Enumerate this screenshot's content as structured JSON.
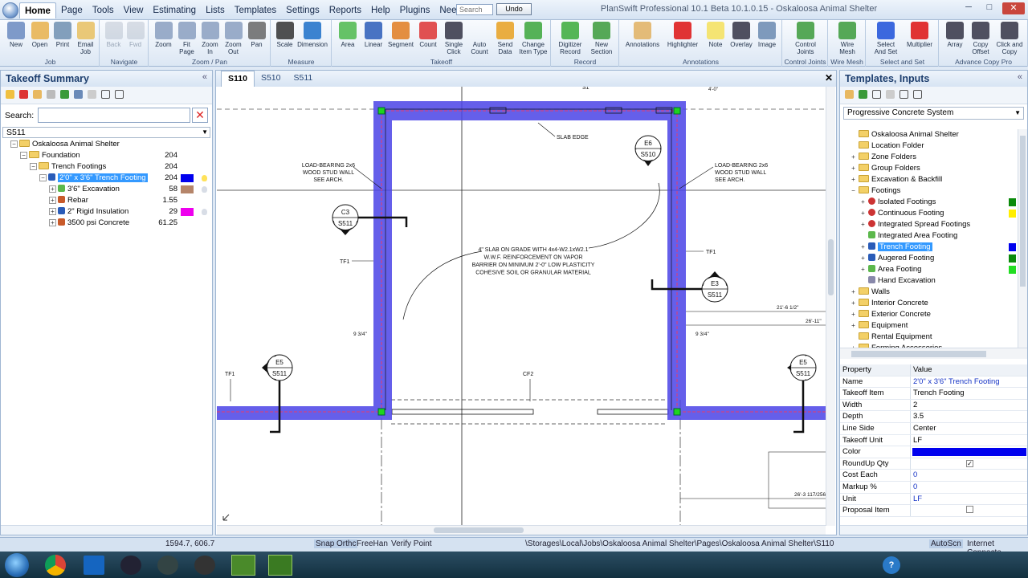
{
  "menu": {
    "items": [
      "Home",
      "Page",
      "Tools",
      "View",
      "Estimating",
      "Lists",
      "Templates",
      "Settings",
      "Reports",
      "Help",
      "Plugins",
      "Need Work?"
    ],
    "search_placeholder": "Search",
    "undo_label": "Undo"
  },
  "window_title": "PlanSwift Professional 10.1 Beta  10.1.0.15 - Oskaloosa Animal Shelter",
  "ribbon": {
    "groups": [
      {
        "label": "Job",
        "buttons": [
          "New",
          "Open",
          "Print",
          "Email\nJob"
        ]
      },
      {
        "label": "Navigate",
        "buttons": [
          "Back",
          "Fwd"
        ]
      },
      {
        "label": "Zoom / Pan",
        "buttons": [
          "Zoom",
          "Fit\nPage",
          "Zoom\nIn",
          "Zoom\nOut",
          "Pan"
        ]
      },
      {
        "label": "Measure",
        "buttons": [
          "Scale",
          "Dimension"
        ]
      },
      {
        "label": "Takeoff",
        "buttons": [
          "Area",
          "Linear",
          "Segment",
          "Count",
          "Single\nClick",
          "Auto\nCount",
          "Send\nData",
          "Change\nItem Type"
        ]
      },
      {
        "label": "Record",
        "buttons": [
          "Digitizer\nRecord",
          "New\nSection"
        ]
      },
      {
        "label": "Annotations",
        "buttons": [
          "Annotations",
          "Highlighter",
          "Note",
          "Overlay",
          "Image"
        ]
      },
      {
        "label": "Control Joints",
        "buttons": [
          "Control\nJoints"
        ]
      },
      {
        "label": "Wire Mesh",
        "buttons": [
          "Wire\nMesh"
        ]
      },
      {
        "label": "Select and Set",
        "buttons": [
          "Select\nAnd Set",
          "Multiplier"
        ]
      },
      {
        "label": "Advance Copy Pro",
        "buttons": [
          "Array",
          "Copy\nOffset",
          "Click and\nCopy"
        ]
      }
    ]
  },
  "left_panel": {
    "title": "Takeoff Summary",
    "search_label": "Search:",
    "page_select": "S511",
    "tree": [
      {
        "label": "Oskaloosa Animal Shelter",
        "value": "",
        "level": 0,
        "kind": "folder"
      },
      {
        "label": "Foundation",
        "value": "204",
        "level": 1,
        "kind": "folder"
      },
      {
        "label": "Trench Footings",
        "value": "204",
        "level": 2,
        "kind": "folder"
      },
      {
        "label": "2'0\" x 3'6\" Trench Footing",
        "value": "204",
        "level": 3,
        "kind": "linear",
        "selected": true,
        "swatch": "#0000ee"
      },
      {
        "label": "3'6\" Excavation",
        "value": "58",
        "level": 4,
        "kind": "area",
        "swatch": "#b5856a"
      },
      {
        "label": "Rebar",
        "value": "1.55",
        "level": 4,
        "kind": "item"
      },
      {
        "label": "2\" Rigid Insulation",
        "value": "29",
        "level": 4,
        "kind": "linear",
        "swatch": "#ee00ee"
      },
      {
        "label": "3500 psi Concrete",
        "value": "61.25",
        "level": 4,
        "kind": "item"
      }
    ]
  },
  "tabs": [
    "S110",
    "S510",
    "S511"
  ],
  "drawing": {
    "labels": {
      "slab_edge": "SLAB EDGE",
      "left_wall": [
        "LOAD-BEARING 2x6",
        "WOOD STUD WALL",
        "SEE ARCH."
      ],
      "right_wall": [
        "LOAD-BEARING 2x6",
        "WOOD STUD WALL",
        "SEE ARCH."
      ],
      "slab_note": [
        "4\" SLAB ON GRADE WITH 4x4-W2.1xW2.1",
        "W.W.F. REINFORCEMENT ON VAPOR",
        "BARRIER ON MINIMUM 2'-0\" LOW PLASTICITY",
        "COHESIVE SOIL OR GRANULAR MATERIAL"
      ],
      "tf1": "TF1",
      "cf2": "CF2",
      "dim_9_3_4": "9 3/4\"",
      "dim_21_6": "21'-6 1/2\"",
      "dim_26_11": "26'-11\"",
      "dim_26_3": "26'-3 117/256\"",
      "s1": "S1",
      "four_zero": "4'-0\""
    },
    "callouts": [
      {
        "top": "E6",
        "bottom": "S510"
      },
      {
        "top": "C3",
        "bottom": "S511"
      },
      {
        "top": "E3",
        "bottom": "S511"
      },
      {
        "top": "E5",
        "bottom": "S511"
      },
      {
        "top": "E5",
        "bottom": "S511"
      }
    ]
  },
  "right_panel": {
    "title": "Templates, Inputs",
    "template_select": "Progressive Concrete System",
    "tree": [
      {
        "label": "Oskaloosa Animal Shelter",
        "level": 0,
        "kind": "folder"
      },
      {
        "label": "Location Folder",
        "level": 0,
        "kind": "folder"
      },
      {
        "label": "Zone Folders",
        "level": 0,
        "kind": "folder",
        "expand": "+"
      },
      {
        "label": "Group Folders",
        "level": 0,
        "kind": "folder",
        "expand": "+"
      },
      {
        "label": "Excavation & Backfill",
        "level": 0,
        "kind": "folder",
        "expand": "+"
      },
      {
        "label": "Footings",
        "level": 0,
        "kind": "folder",
        "expand": "-"
      },
      {
        "label": "Isolated Footings",
        "level": 1,
        "kind": "count",
        "swatch": "#0a8a0a",
        "expand": "+"
      },
      {
        "label": "Continuous Footing",
        "level": 1,
        "kind": "count",
        "swatch": "#ffee00",
        "expand": "+"
      },
      {
        "label": "Integrated Spread Footings",
        "level": 1,
        "kind": "count",
        "expand": "+"
      },
      {
        "label": "Integrated Area Footing",
        "level": 1,
        "kind": "area"
      },
      {
        "label": "Trench Footing",
        "level": 1,
        "kind": "linear",
        "selected": true,
        "swatch": "#0000ee",
        "expand": "+"
      },
      {
        "label": "Augered Footing",
        "level": 1,
        "kind": "linear",
        "swatch": "#0a8a0a",
        "expand": "+"
      },
      {
        "label": "Area Footing",
        "level": 1,
        "kind": "area",
        "swatch": "#22dd22",
        "expand": "+"
      },
      {
        "label": "Hand Excavation",
        "level": 1,
        "kind": "tool"
      },
      {
        "label": "Walls",
        "level": 0,
        "kind": "folder",
        "expand": "+"
      },
      {
        "label": "Interior Concrete",
        "level": 0,
        "kind": "folder",
        "expand": "+"
      },
      {
        "label": "Exterior Concrete",
        "level": 0,
        "kind": "folder",
        "expand": "+"
      },
      {
        "label": "Equipment",
        "level": 0,
        "kind": "folder",
        "expand": "+"
      },
      {
        "label": "Rental Equipment",
        "level": 0,
        "kind": "folder"
      },
      {
        "label": "Forming Accessories",
        "level": 0,
        "kind": "folder",
        "expand": "+"
      }
    ],
    "properties_header": {
      "k": "Property",
      "v": "Value"
    },
    "properties": [
      {
        "k": "Name",
        "v": "2'0\" x 3'6\" Trench Footing",
        "blue": true
      },
      {
        "k": "Takeoff Item",
        "v": "Trench Footing"
      },
      {
        "k": "Width",
        "v": "2"
      },
      {
        "k": "Depth",
        "v": "3.5"
      },
      {
        "k": "Line Side",
        "v": "Center"
      },
      {
        "k": "Takeoff Unit",
        "v": "LF"
      },
      {
        "k": "Color",
        "v": "",
        "color": "#0000ee"
      },
      {
        "k": "RoundUp Qty",
        "v": "",
        "check": true
      },
      {
        "k": "Cost Each",
        "v": "0",
        "blue": true
      },
      {
        "k": "Markup %",
        "v": "0",
        "blue": true
      },
      {
        "k": "Unit",
        "v": "LF",
        "blue": true
      },
      {
        "k": "Proposal Item",
        "v": "",
        "check": false
      }
    ]
  },
  "status": {
    "coords": "1594.7, 606.7",
    "snap": "Snap",
    "ortho": "Orthc",
    "freehand": "FreeHan",
    "verify": "Verify Point",
    "path": "\\Storages\\Local\\Jobs\\Oskaloosa Animal Shelter\\Pages\\Oskaloosa Animal Shelter\\S110",
    "autoscroll": "AutoScn",
    "internet": "Internet Connecte"
  },
  "colors": {
    "accent": "#1d3e6e",
    "footing": "#4a43e6",
    "footing_dark": "#2a22c9",
    "selected": "#3399ff"
  }
}
